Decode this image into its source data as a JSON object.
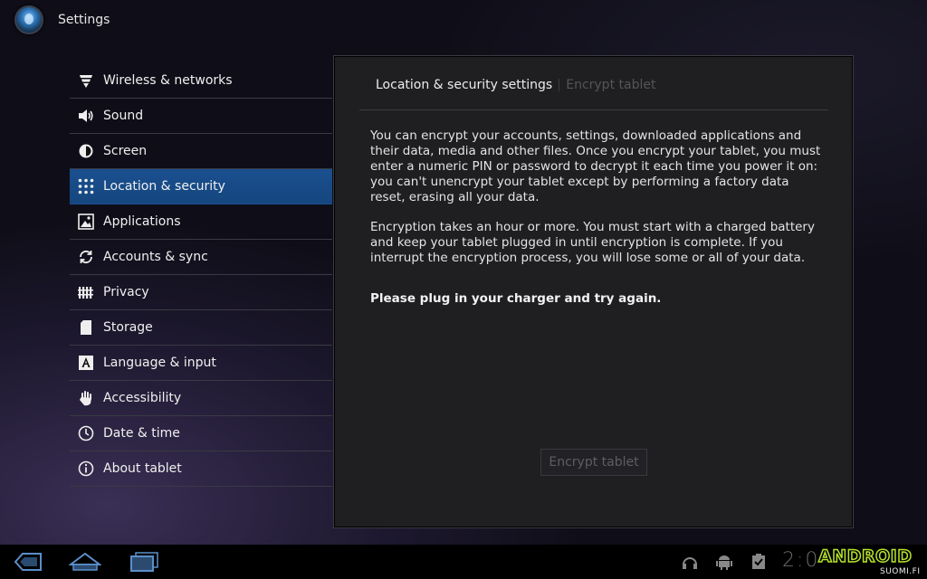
{
  "app": {
    "title": "Settings",
    "icon": "settings-app-icon"
  },
  "sidebar": {
    "items": [
      {
        "label": "Wireless & networks",
        "icon": "wifi-icon",
        "active": false
      },
      {
        "label": "Sound",
        "icon": "speaker-icon",
        "active": false
      },
      {
        "label": "Screen",
        "icon": "brightness-icon",
        "active": false
      },
      {
        "label": "Location & security",
        "icon": "location-grid-icon",
        "active": true
      },
      {
        "label": "Applications",
        "icon": "applications-icon",
        "active": false
      },
      {
        "label": "Accounts & sync",
        "icon": "sync-icon",
        "active": false
      },
      {
        "label": "Privacy",
        "icon": "privacy-icon",
        "active": false
      },
      {
        "label": "Storage",
        "icon": "sd-card-icon",
        "active": false
      },
      {
        "label": "Language & input",
        "icon": "language-icon",
        "active": false
      },
      {
        "label": "Accessibility",
        "icon": "hand-icon",
        "active": false
      },
      {
        "label": "Date & time",
        "icon": "clock-icon",
        "active": false
      },
      {
        "label": "About tablet",
        "icon": "info-icon",
        "active": false
      }
    ]
  },
  "panel": {
    "breadcrumb": [
      "Location & security settings",
      "Encrypt tablet"
    ],
    "paragraph_1": "You can encrypt your accounts, settings, downloaded applications and their data, media and other files. Once you encrypt your tablet, you must enter a numeric PIN or password to decrypt it each time you power it on: you can't unencrypt your tablet except by performing a factory data reset, erasing all your data.",
    "paragraph_2": "Encryption takes an hour or more. You must start with a charged battery and keep your tablet plugged in until encryption is complete. If you interrupt the encryption process, you will lose some or all of your data.",
    "notice": "Please plug in your charger and try again.",
    "button_label": "Encrypt tablet"
  },
  "system_bar": {
    "buttons": [
      "back-icon",
      "home-icon",
      "recent-apps-icon"
    ],
    "status_icons": [
      "headphones-icon",
      "android-debug-icon",
      "clipboard-check-icon"
    ],
    "clock": "2:0"
  },
  "watermark": {
    "text": "ANDROID",
    "sub": "SUOMI.FI"
  },
  "colors": {
    "accent": "#1a4f8f",
    "watermark": "#b6e32a"
  }
}
